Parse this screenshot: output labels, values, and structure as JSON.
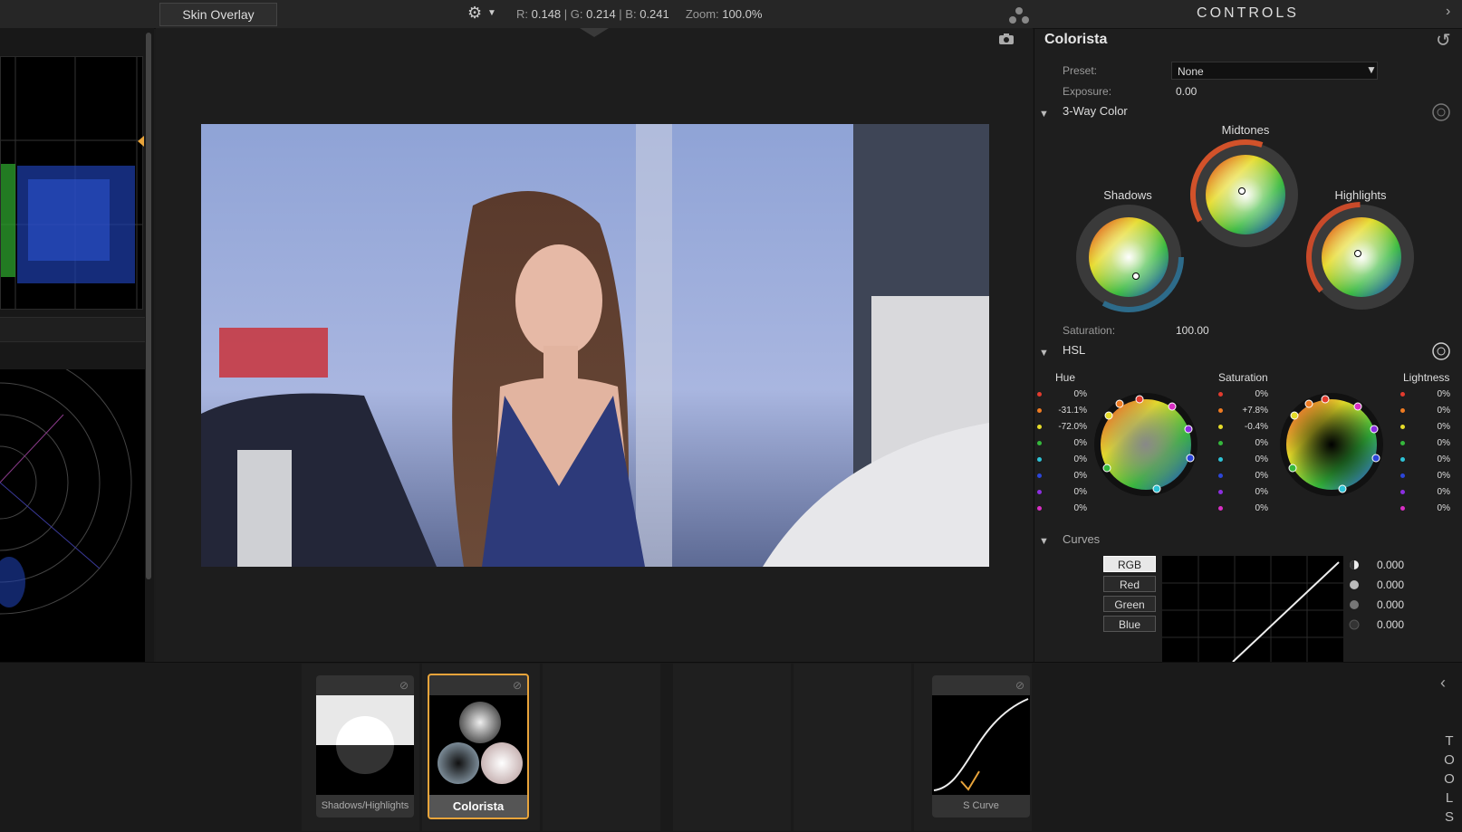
{
  "topbar": {
    "overlay_label": "Skin Overlay",
    "r_label": "R:",
    "r_value": "0.148",
    "g_label": "G:",
    "g_value": "0.214",
    "b_label": "B:",
    "b_value": "0.241",
    "zoom_label": "Zoom:",
    "zoom_value": "100.0%"
  },
  "controls": {
    "title": "CONTROLS",
    "effect_name": "Colorista",
    "preset_label": "Preset:",
    "preset_value": "None",
    "exposure_label": "Exposure:",
    "exposure_value": "0.00",
    "three_way": {
      "title": "3-Way Color",
      "shadows": "Shadows",
      "midtones": "Midtones",
      "highlights": "Highlights",
      "saturation_label": "Saturation:",
      "saturation_value": "100.00"
    },
    "hsl": {
      "title": "HSL",
      "hue_title": "Hue",
      "sat_title": "Saturation",
      "light_title": "Lightness",
      "rows": [
        {
          "color": "#e23b2e",
          "hue": "0%",
          "sat": "0%",
          "light": "0%"
        },
        {
          "color": "#ef7b22",
          "hue": "-31.1%",
          "sat": "+7.8%",
          "light": "0%"
        },
        {
          "color": "#e6dc2a",
          "hue": "-72.0%",
          "sat": "-0.4%",
          "light": "0%"
        },
        {
          "color": "#35b83c",
          "hue": "0%",
          "sat": "0%",
          "light": "0%"
        },
        {
          "color": "#2ec3d6",
          "hue": "0%",
          "sat": "0%",
          "light": "0%"
        },
        {
          "color": "#2c46d9",
          "hue": "0%",
          "sat": "0%",
          "light": "0%"
        },
        {
          "color": "#8b2fe0",
          "hue": "0%",
          "sat": "0%",
          "light": "0%"
        },
        {
          "color": "#d92fc4",
          "hue": "0%",
          "sat": "0%",
          "light": "0%"
        }
      ]
    },
    "curves": {
      "title": "Curves",
      "buttons": [
        "RGB",
        "Red",
        "Green",
        "Blue"
      ],
      "values": [
        "0.000",
        "0.000",
        "0.000",
        "0.000"
      ]
    }
  },
  "tray": {
    "cards": [
      "Shadows/Highlights",
      "Colorista",
      "S Curve"
    ],
    "tools_label": "TOOLS"
  },
  "colors": {
    "accent": "#e8a43b"
  }
}
